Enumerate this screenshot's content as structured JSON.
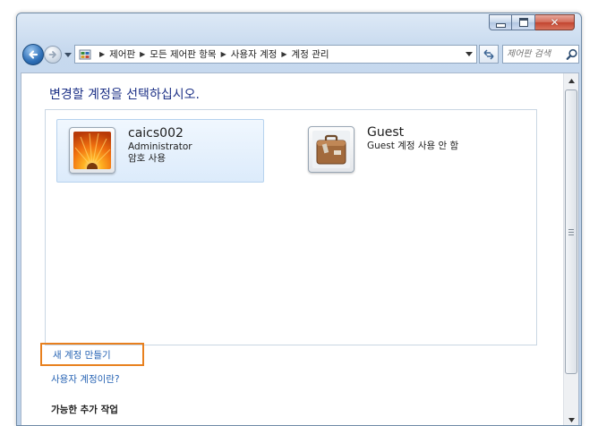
{
  "window": {
    "caption_buttons": {
      "minimize_icon": "minimize-icon",
      "maximize_icon": "maximize-icon",
      "close_glyph": "✕"
    }
  },
  "navigation": {
    "back_icon": "back-arrow-icon",
    "forward_icon": "forward-arrow-icon",
    "breadcrumbs": [
      "제어판",
      "모든 제어판 항목",
      "사용자 계정",
      "계정 관리"
    ],
    "refresh_icon": "refresh-icon",
    "search_placeholder": "제어판 검색"
  },
  "main": {
    "title": "변경할 계정을 선택하십시오.",
    "accounts": [
      {
        "name": "caics002",
        "role": "Administrator",
        "status": "암호 사용",
        "selected": true,
        "picture": "orange-flower"
      },
      {
        "name": "Guest",
        "status": "Guest 계정 사용 안 함",
        "selected": false,
        "picture": "suitcase"
      }
    ],
    "create_account_link": "새 계정 만들기",
    "what_is_account_link": "사용자 계정이란?",
    "additional_tasks_heading": "가능한 추가 작업"
  },
  "colors": {
    "title_blue": "#1e3287",
    "link_blue": "#2864b4",
    "highlight_orange": "#e8801e"
  }
}
